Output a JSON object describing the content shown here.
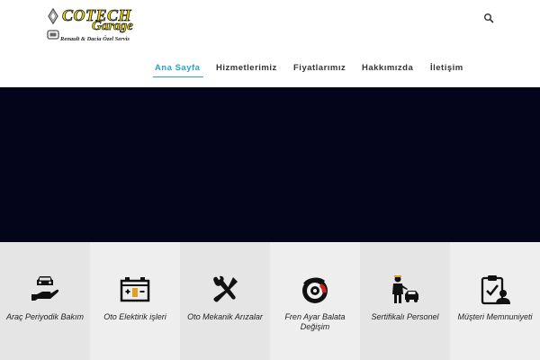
{
  "header": {
    "logo": {
      "brand_line1": "COTECH",
      "brand_line2": "Garage",
      "tagline": "Renault & Dacia Özel Servis"
    },
    "search_icon": "search-icon"
  },
  "nav": {
    "items": [
      {
        "label": "Ana Sayfa",
        "active": true
      },
      {
        "label": "Hizmetlerimiz",
        "active": false
      },
      {
        "label": "Fiyatlarımız",
        "active": false
      },
      {
        "label": "Hakkımızda",
        "active": false
      },
      {
        "label": "İletişim",
        "active": false
      }
    ],
    "active_color": "#29a3c9"
  },
  "hero": {
    "background": "#04051a"
  },
  "services": [
    {
      "label": "Araç Periyodik Bakım",
      "icon": "car-hand-icon"
    },
    {
      "label": "Oto Elektirik işleri",
      "icon": "battery-icon"
    },
    {
      "label": "Oto Mekanik Arızalar",
      "icon": "wrench-screwdriver-icon"
    },
    {
      "label": "Fren Ayar Balata Değişim",
      "icon": "brake-disc-icon"
    },
    {
      "label": "Sertifikalı Personel",
      "icon": "mechanic-car-icon"
    },
    {
      "label": "Müşteri Memnuniyeti",
      "icon": "clipboard-check-icon"
    }
  ]
}
